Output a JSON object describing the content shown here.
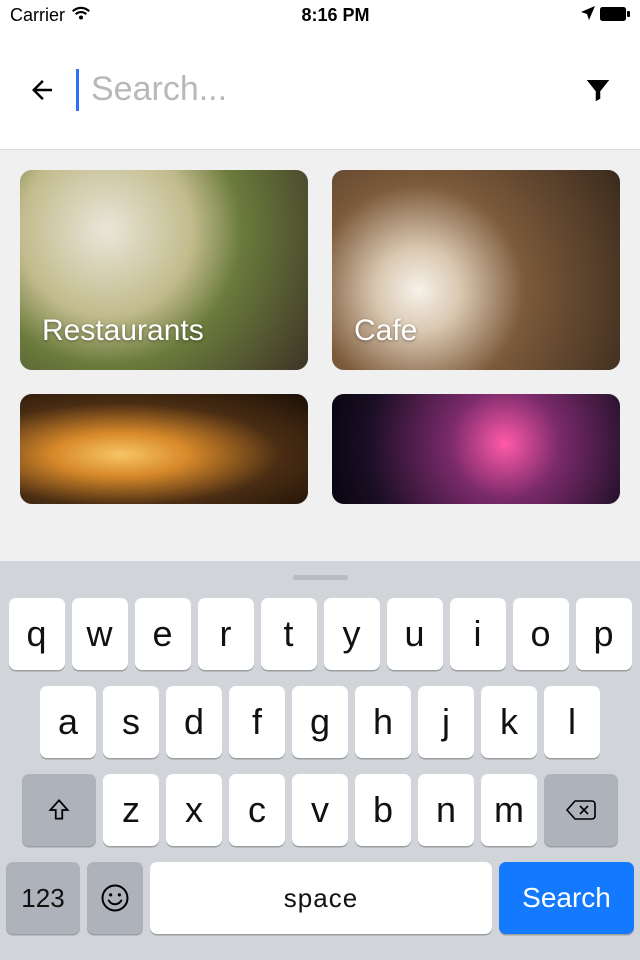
{
  "status": {
    "carrier": "Carrier",
    "time": "8:16 PM"
  },
  "search": {
    "placeholder": "Search...",
    "value": ""
  },
  "categories": [
    {
      "label": "Restaurants"
    },
    {
      "label": "Cafe"
    },
    {
      "label": ""
    },
    {
      "label": ""
    }
  ],
  "keyboard": {
    "row1": [
      "q",
      "w",
      "e",
      "r",
      "t",
      "y",
      "u",
      "i",
      "o",
      "p"
    ],
    "row2": [
      "a",
      "s",
      "d",
      "f",
      "g",
      "h",
      "j",
      "k",
      "l"
    ],
    "row3": [
      "z",
      "x",
      "c",
      "v",
      "b",
      "n",
      "m"
    ],
    "numKey": "123",
    "space": "space",
    "action": "Search"
  }
}
